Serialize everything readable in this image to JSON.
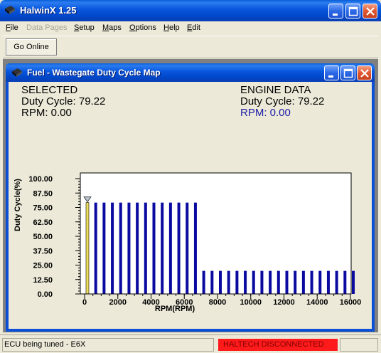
{
  "app": {
    "title": "HalwinX 1.25"
  },
  "menu": [
    {
      "label": "File",
      "enabled": true
    },
    {
      "label": "Data Pages",
      "enabled": false
    },
    {
      "label": "Setup",
      "enabled": true
    },
    {
      "label": "Maps",
      "enabled": true
    },
    {
      "label": "Options",
      "enabled": true
    },
    {
      "label": "Help",
      "enabled": true
    },
    {
      "label": "Edit",
      "enabled": true
    }
  ],
  "toolbar": {
    "go_online_label": "Go Online"
  },
  "child_window": {
    "title": "Fuel - Wastegate Duty Cycle Map"
  },
  "selected": {
    "heading": "SELECTED",
    "duty_cycle_text": "Duty Cycle: 79.22",
    "rpm_text": "RPM: 0.00"
  },
  "engine_data": {
    "heading": "ENGINE DATA",
    "duty_cycle_text": "Duty Cycle: 79.22",
    "rpm_text": "RPM: 0.00"
  },
  "chart_data": {
    "type": "bar",
    "xlabel": "RPM(RPM)",
    "ylabel": "Duty Cycle(%)",
    "ylim": [
      0,
      100
    ],
    "xlim": [
      0,
      16000
    ],
    "y_ticks": [
      "100.00",
      "87.50",
      "75.00",
      "62.50",
      "50.00",
      "37.50",
      "25.00",
      "12.50",
      "0.00"
    ],
    "x_ticks": [
      "0",
      "2000",
      "4000",
      "6000",
      "8000",
      "10000",
      "12000",
      "14000",
      "16000"
    ],
    "x": [
      0,
      500,
      1000,
      1500,
      2000,
      2500,
      3000,
      3500,
      4000,
      4500,
      5000,
      5500,
      6000,
      6500,
      7000,
      7500,
      8000,
      8500,
      9000,
      9500,
      10000,
      10500,
      11000,
      11500,
      12000,
      12500,
      13000,
      13500,
      14000,
      14500,
      15000,
      15500,
      16000
    ],
    "values": [
      79.22,
      79.22,
      79.22,
      79.22,
      79.22,
      79.22,
      79.22,
      79.22,
      79.22,
      79.22,
      79.22,
      79.22,
      79.22,
      79.22,
      20,
      20,
      20,
      20,
      20,
      20,
      20,
      20,
      20,
      20,
      20,
      20,
      20,
      20,
      20,
      20,
      20,
      20,
      20
    ],
    "selected_index": 0,
    "bar_color": "#0a0aa0",
    "selected_bar_color": "#f0e060",
    "grid": false
  },
  "status": {
    "left_text": "ECU being tuned - E6X",
    "right_text": "HALTECH DISCONNECTED",
    "right_color": "#ff1b1b"
  }
}
